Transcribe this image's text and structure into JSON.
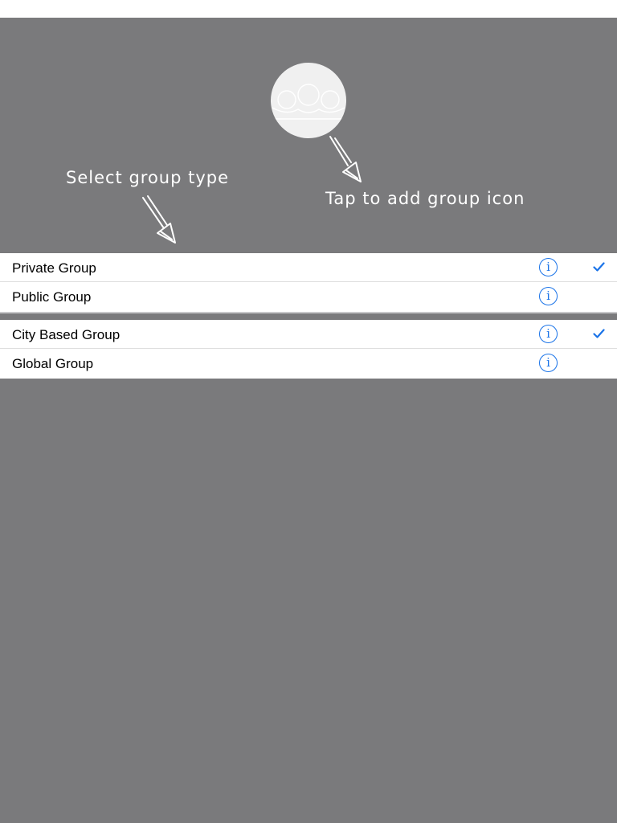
{
  "coach": {
    "select_group_type": "Select group type",
    "tap_to_add_icon": "Tap to add group icon"
  },
  "sections": [
    {
      "rows": [
        {
          "label": "Private Group",
          "checked": true
        },
        {
          "label": "Public Group",
          "checked": false
        }
      ]
    },
    {
      "rows": [
        {
          "label": "City Based Group",
          "checked": true
        },
        {
          "label": "Global Group",
          "checked": false
        }
      ]
    }
  ],
  "icons": {
    "info": "info-icon",
    "check": "checkmark-icon",
    "group_avatar": "group-avatar-icon"
  },
  "colors": {
    "overlay": "#7a7a7c",
    "accent": "#1a73e8"
  }
}
